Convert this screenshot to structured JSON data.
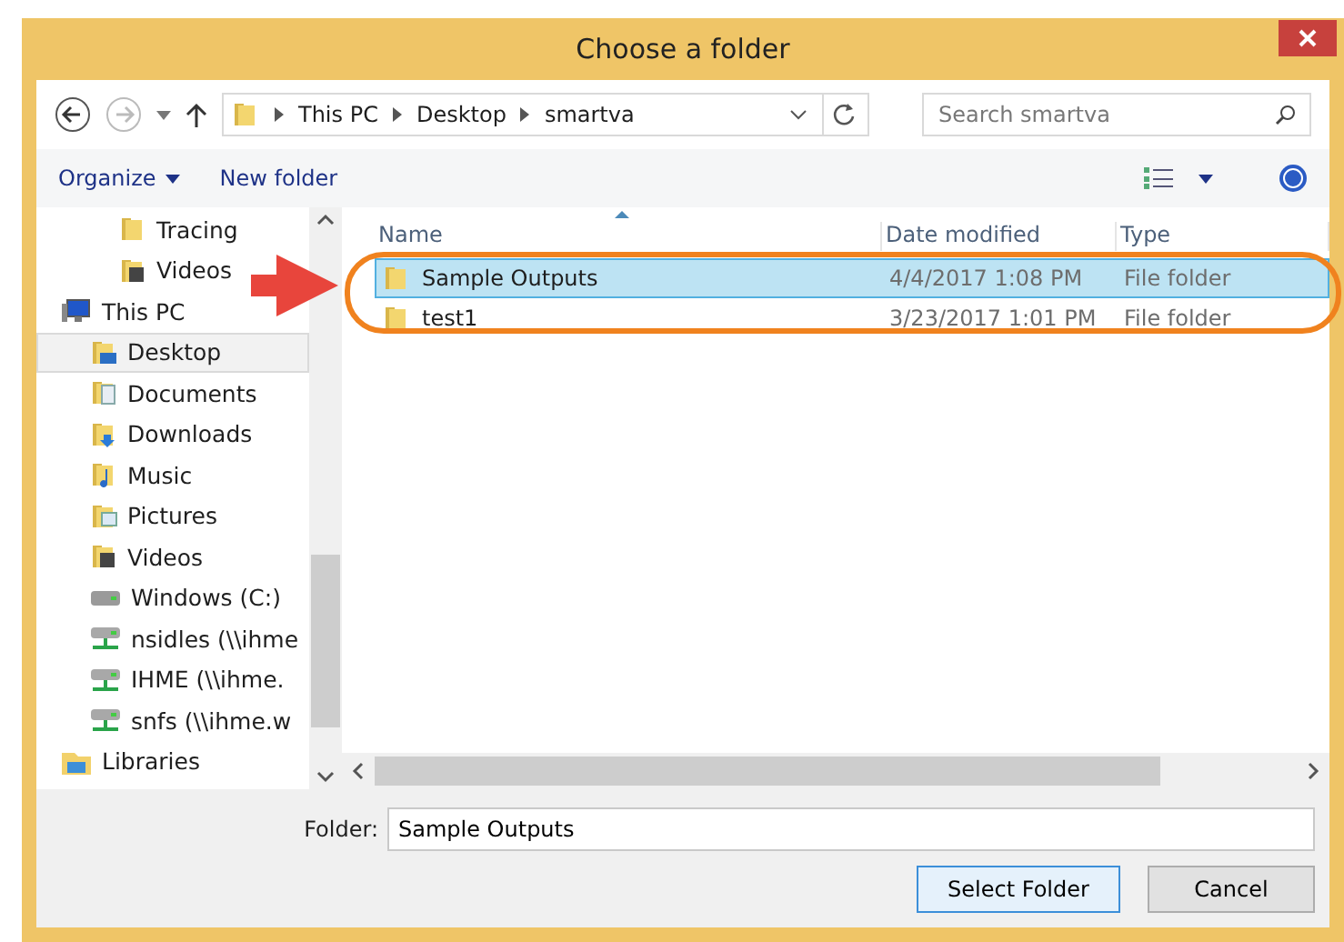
{
  "window": {
    "title": "Choose a folder"
  },
  "navigation": {
    "path": [
      "This PC",
      "Desktop",
      "smartva"
    ],
    "search": {
      "placeholder": "Search smartva"
    }
  },
  "command_bar": {
    "buttons": [
      "Organize",
      "New folder"
    ]
  },
  "sidebar": {
    "items": [
      {
        "children": [
          {
            "label": "Tracing",
            "kind": "folder",
            "selected": false
          },
          {
            "label": "Videos",
            "kind": "videos",
            "selected": false
          }
        ]
      },
      {
        "label": "This PC",
        "kind": "pc",
        "selected": false,
        "children": [
          {
            "label": "Desktop",
            "kind": "desktop",
            "selected": true
          },
          {
            "label": "Documents",
            "kind": "documents",
            "selected": false
          },
          {
            "label": "Downloads",
            "kind": "downloads",
            "selected": false
          },
          {
            "label": "Music",
            "kind": "music",
            "selected": false
          },
          {
            "label": "Pictures",
            "kind": "pictures",
            "selected": false
          },
          {
            "label": "Videos",
            "kind": "videos",
            "selected": false
          },
          {
            "label": "Windows (C:)",
            "kind": "drive",
            "selected": false
          },
          {
            "label": "nsidles (\\\\ihme",
            "kind": "network",
            "selected": false
          },
          {
            "label": "IHME (\\\\ihme.",
            "kind": "network",
            "selected": false
          },
          {
            "label": "snfs (\\\\ihme.w",
            "kind": "network",
            "selected": false
          }
        ]
      },
      {
        "label": "Libraries",
        "kind": "library",
        "selected": false
      }
    ]
  },
  "table": {
    "columns": [
      "Name",
      "Date modified",
      "Type"
    ],
    "rows": [
      {
        "name": "Sample Outputs",
        "date": "4/4/2017 1:08 PM",
        "type": "File folder",
        "selected": true
      },
      {
        "name": "test1",
        "date": "3/23/2017 1:01 PM",
        "type": "File folder",
        "selected": false
      }
    ]
  },
  "folder_field": {
    "label": "Folder:",
    "value": "Sample Outputs"
  },
  "buttons": [
    {
      "label": "Select Folder",
      "kind": "primary"
    },
    {
      "label": "Cancel",
      "kind": "secondary"
    }
  ]
}
